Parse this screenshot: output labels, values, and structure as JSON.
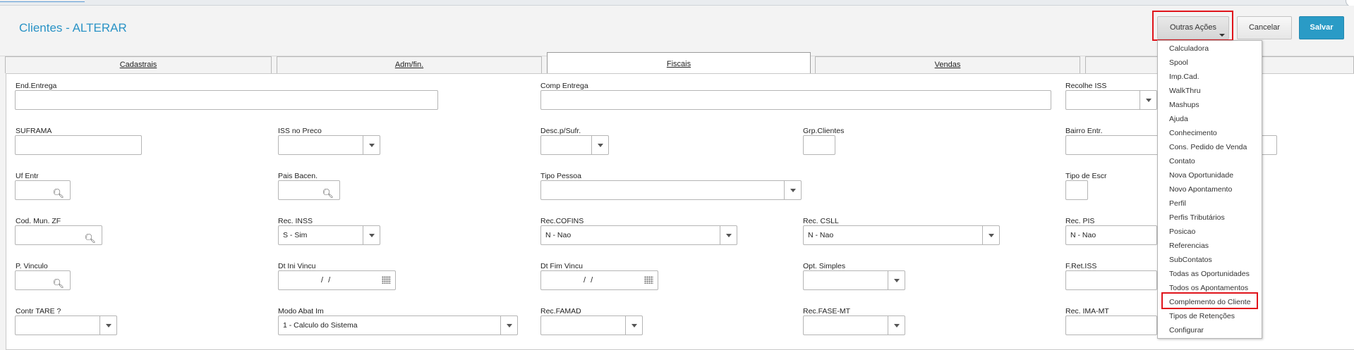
{
  "header": {
    "title": "Clientes - ALTERAR",
    "outras_label": "Outras Ações",
    "cancelar_label": "Cancelar",
    "salvar_label": "Salvar"
  },
  "tabs": [
    "Cadastrais",
    "Adm/fin.",
    "Fiscais",
    "Vendas"
  ],
  "active_tab": "Fiscais",
  "fields": {
    "end_entrega": {
      "label": "End.Entrega",
      "value": ""
    },
    "comp_entrega": {
      "label": "Comp Entrega",
      "value": ""
    },
    "recolhe_iss": {
      "label": "Recolhe ISS",
      "value": ""
    },
    "suframa": {
      "label": "SUFRAMA",
      "value": ""
    },
    "iss_no_preco": {
      "label": "ISS no Preco",
      "value": ""
    },
    "desc_sufr": {
      "label": "Desc.p/Sufr.",
      "value": ""
    },
    "grp_clientes": {
      "label": "Grp.Clientes",
      "value": ""
    },
    "bairro_entr": {
      "label": "Bairro Entr.",
      "value": ""
    },
    "uf_entr": {
      "label": "Uf Entr",
      "value": ""
    },
    "pais_bacen": {
      "label": "Pais Bacen.",
      "value": ""
    },
    "tipo_pessoa": {
      "label": "Tipo Pessoa",
      "value": ""
    },
    "tipo_de_escr": {
      "label": "Tipo de Escr",
      "value": ""
    },
    "cod_mun_zf": {
      "label": "Cod. Mun. ZF",
      "value": ""
    },
    "rec_inss": {
      "label": "Rec. INSS",
      "value": "S - Sim"
    },
    "rec_cofins": {
      "label": "Rec.COFINS",
      "value": "N - Nao"
    },
    "rec_csll": {
      "label": "Rec. CSLL",
      "value": "N - Nao"
    },
    "rec_pis": {
      "label": "Rec. PIS",
      "value": "N - Nao"
    },
    "p_vinculo": {
      "label": "P. Vinculo",
      "value": ""
    },
    "dt_ini_vincu": {
      "label": "Dt Ini Vincu",
      "value": "/ /"
    },
    "dt_fim_vincu": {
      "label": "Dt Fim Vincu",
      "value": "/ /"
    },
    "opt_simples": {
      "label": "Opt. Simples",
      "value": ""
    },
    "f_ret_iss": {
      "label": "F.Ret.ISS",
      "value": ""
    },
    "contr_tare": {
      "label": "Contr TARE ?",
      "value": ""
    },
    "modo_abat_im": {
      "label": "Modo Abat Im",
      "value": "1 - Calculo do Sistema"
    },
    "rec_famad": {
      "label": "Rec.FAMAD",
      "value": ""
    },
    "rec_fase_mt": {
      "label": "Rec.FASE-MT",
      "value": ""
    },
    "rec_ima_mt": {
      "label": "Rec. IMA-MT",
      "value": ""
    }
  },
  "menu": [
    "Calculadora",
    "Spool",
    "Imp.Cad.",
    "WalkThru",
    "Mashups",
    "Ajuda",
    "Conhecimento",
    "Cons. Pedido de Venda",
    "Contato",
    "Nova Oportunidade",
    "Novo Apontamento",
    "Perfil",
    "Perfis Tributários",
    "Posicao",
    "Referencias",
    "SubContatos",
    "Todas as Oportunidades",
    "Todos os Apontamentos",
    "Complemento do Cliente",
    "Tipos de Retenções",
    "Configurar"
  ],
  "highlight_color": "#e0141b",
  "accent_color": "#2a93c6"
}
